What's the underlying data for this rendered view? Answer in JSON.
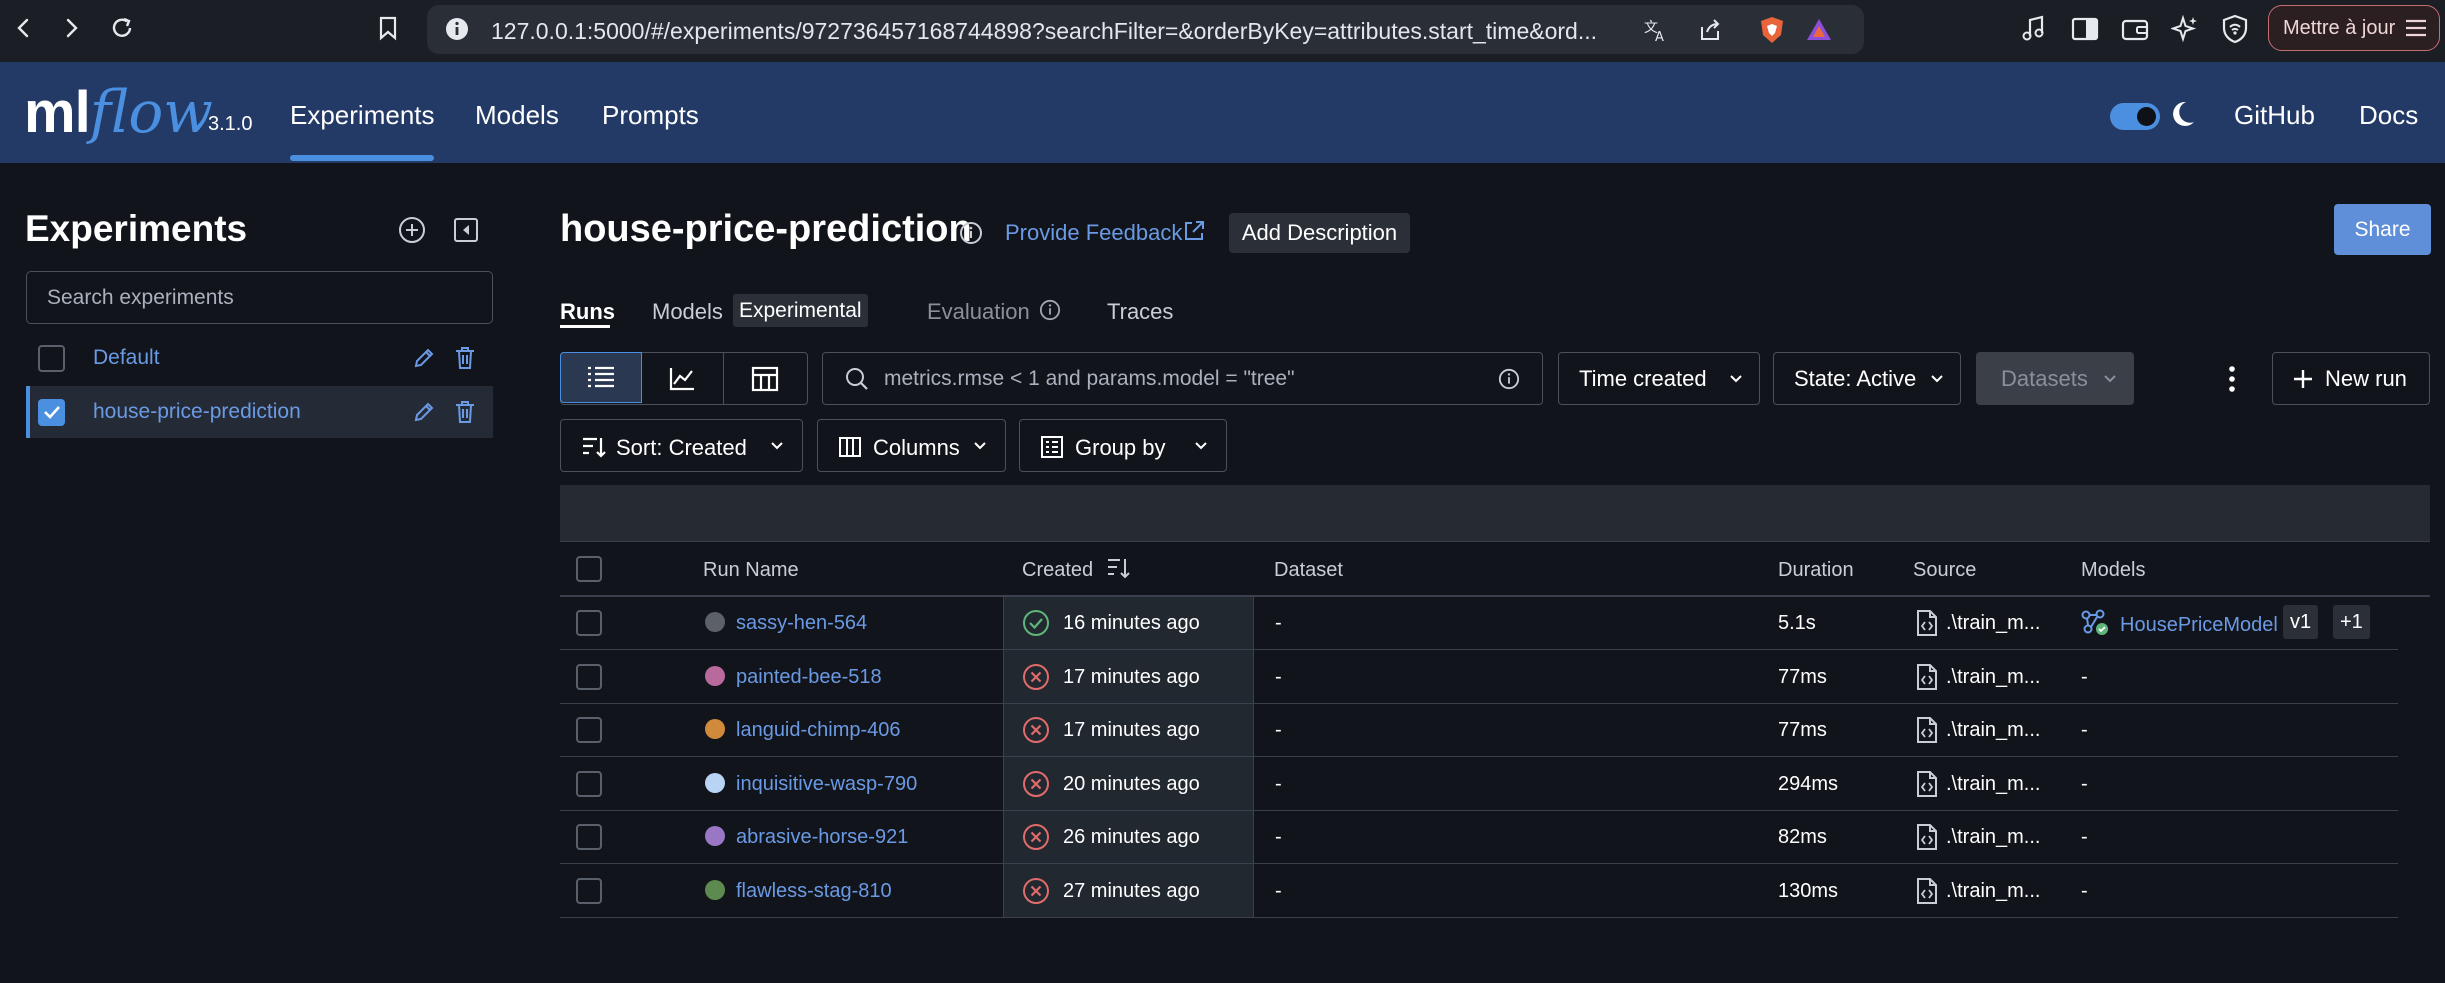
{
  "browser": {
    "url": "127.0.0.1:5000/#/experiments/972736457168744898?searchFilter=&orderByKey=attributes.start_time&ord...",
    "update_button": "Mettre à jour"
  },
  "header": {
    "logo_ml": "ml",
    "logo_flow": "flow",
    "version": "3.1.0",
    "nav": [
      "Experiments",
      "Models",
      "Prompts"
    ],
    "active_nav": "Experiments",
    "github": "GitHub",
    "docs": "Docs",
    "dark_mode": true
  },
  "sidebar": {
    "title": "Experiments",
    "search_placeholder": "Search experiments",
    "experiments": [
      {
        "name": "Default",
        "checked": false
      },
      {
        "name": "house-price-prediction",
        "checked": true
      }
    ]
  },
  "main": {
    "title": "house-price-prediction",
    "feedback": "Provide Feedback",
    "add_description": "Add Description",
    "share": "Share",
    "tabs": {
      "runs": "Runs",
      "models": "Models",
      "experimental": "Experimental",
      "evaluation": "Evaluation",
      "traces": "Traces"
    },
    "search_placeholder": "metrics.rmse < 1 and params.model = \"tree\"",
    "time_created": "Time created",
    "state": "State: Active",
    "datasets": "Datasets",
    "new_run": "New run",
    "sort": "Sort: Created",
    "columns": "Columns",
    "group_by": "Group by"
  },
  "table": {
    "headers": {
      "run_name": "Run Name",
      "created": "Created",
      "dataset": "Dataset",
      "duration": "Duration",
      "source": "Source",
      "models": "Models"
    },
    "rows": [
      {
        "name": "sassy-hen-564",
        "color": "#5c6068",
        "status": "success",
        "created": "16 minutes ago",
        "dataset": "-",
        "duration": "5.1s",
        "source": ".\\train_m...",
        "model": "HousePriceModel",
        "model_version": "v1",
        "model_more": "+1"
      },
      {
        "name": "painted-bee-518",
        "color": "#b86a9c",
        "status": "failed",
        "created": "17 minutes ago",
        "dataset": "-",
        "duration": "77ms",
        "source": ".\\train_m...",
        "model": "-"
      },
      {
        "name": "languid-chimp-406",
        "color": "#d08a3c",
        "status": "failed",
        "created": "17 minutes ago",
        "dataset": "-",
        "duration": "77ms",
        "source": ".\\train_m...",
        "model": "-"
      },
      {
        "name": "inquisitive-wasp-790",
        "color": "#b9d3f5",
        "status": "failed",
        "created": "20 minutes ago",
        "dataset": "-",
        "duration": "294ms",
        "source": ".\\train_m...",
        "model": "-"
      },
      {
        "name": "abrasive-horse-921",
        "color": "#9a77c4",
        "status": "failed",
        "created": "26 minutes ago",
        "dataset": "-",
        "duration": "82ms",
        "source": ".\\train_m...",
        "model": "-"
      },
      {
        "name": "flawless-stag-810",
        "color": "#5d8a4e",
        "status": "failed",
        "created": "27 minutes ago",
        "dataset": "-",
        "duration": "130ms",
        "source": ".\\train_m...",
        "model": "-"
      }
    ]
  },
  "colors": {
    "accent": "#4b8fe0",
    "link": "#6b9ae5",
    "success": "#5fb57a",
    "error": "#e06b6b",
    "header_bg": "#233a66"
  }
}
